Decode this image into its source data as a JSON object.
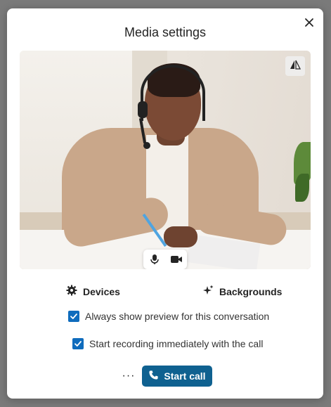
{
  "dialog": {
    "title": "Media settings",
    "close_icon": "close-icon"
  },
  "preview": {
    "mirror_icon": "mirror-icon",
    "mic_icon": "microphone-icon",
    "camera_icon": "camera-icon"
  },
  "options": {
    "devices_label": "Devices",
    "devices_icon": "gear-icon",
    "backgrounds_label": "Backgrounds",
    "backgrounds_icon": "sparkle-icon"
  },
  "checkboxes": [
    {
      "label": "Always show preview for this conversation",
      "checked": true
    },
    {
      "label": "Start recording immediately with the call",
      "checked": true
    }
  ],
  "footer": {
    "more_label": "···",
    "start_label": "Start call",
    "start_icon": "phone-icon"
  },
  "colors": {
    "accent": "#0f6cbd",
    "start_button": "#0f6190",
    "backdrop": "#7a7a7a"
  }
}
